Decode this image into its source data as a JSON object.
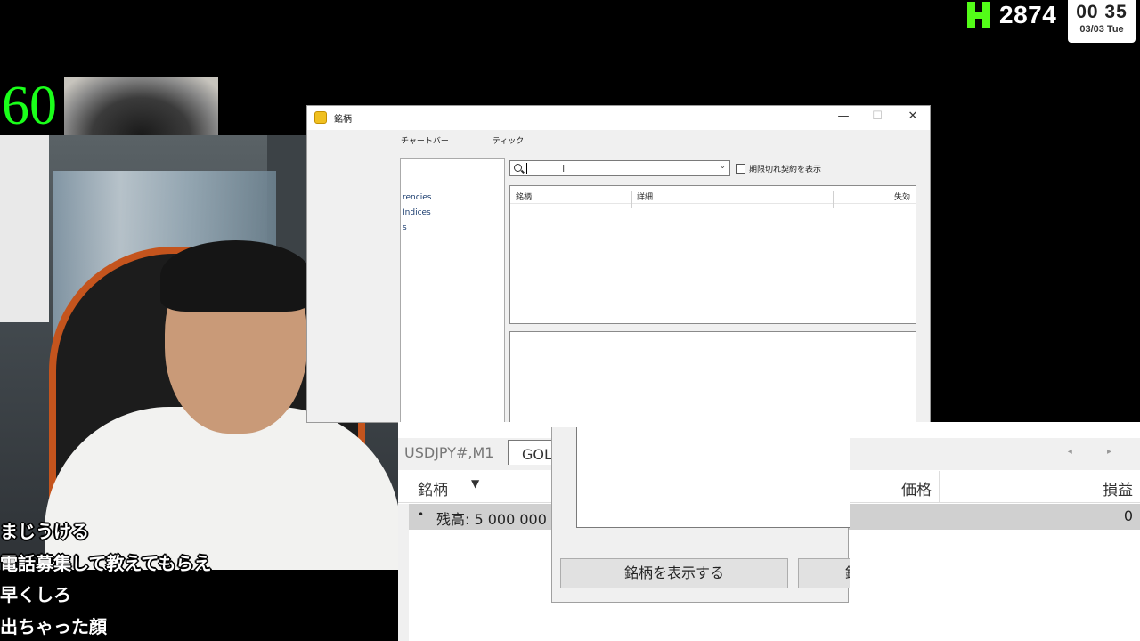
{
  "overlay": {
    "kick_count": "2874",
    "clock_time": "00 35",
    "clock_date": "03/03 Tue",
    "fps": "60",
    "kick_brand_color": "#53fc18"
  },
  "chat": {
    "messages": [
      "まじうける",
      "電話募集して教えてもらえ",
      "早くしろ",
      "出ちゃった顔"
    ]
  },
  "symbols_dialog": {
    "title": "銘柄",
    "window_buttons": [
      "—",
      "☐",
      "✕"
    ],
    "tabs": [
      "チャートバー",
      "ティック"
    ],
    "tree_items": [
      "rencies",
      "Indices",
      "s"
    ],
    "search": {
      "value": "",
      "placeholder": ""
    },
    "expired_label": "期限切れ契約を表示",
    "columns": [
      "銘柄",
      "詳細",
      "失効"
    ]
  },
  "trade_panel": {
    "chart_tabs": [
      "USDJPY#,M1",
      "GOL"
    ],
    "columns": {
      "symbol": "銘柄",
      "price": "価格",
      "profit": "損益"
    },
    "balance_label": "残高: 5 000 000",
    "balance_profit": "0",
    "scroll_arrows": "◂ ▸"
  },
  "symbols_dialog2": {
    "show_button": "銘柄を表示する",
    "second_button_partial": "銘"
  }
}
